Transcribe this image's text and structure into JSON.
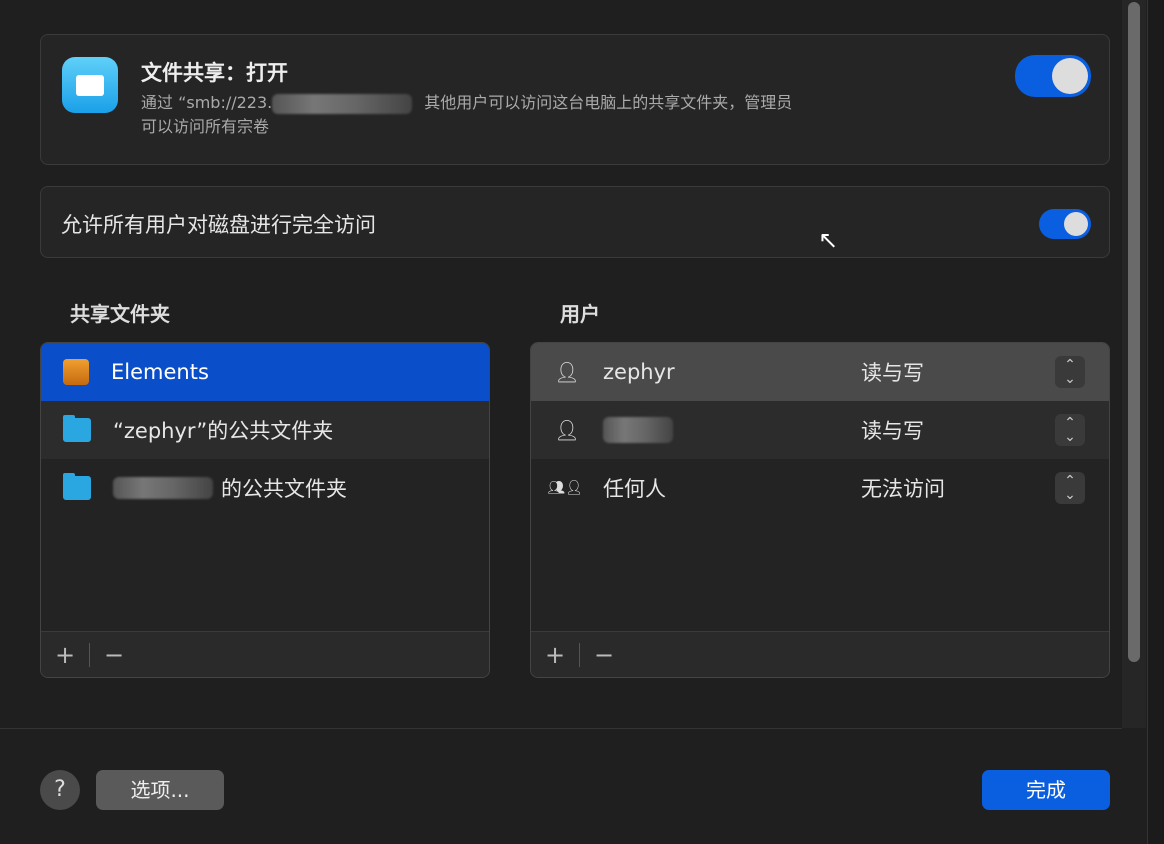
{
  "file_sharing": {
    "title": "文件共享：打开",
    "desc_prefix": "通过 “smb://223.",
    "desc_suffix": "其他用户可以访问这台电脑上的共享文件夹，管理员",
    "desc_line2": "可以访问所有宗卷",
    "enabled": true
  },
  "full_access": {
    "label": "允许所有用户对磁盘进行完全访问",
    "enabled": true
  },
  "shared_folders": {
    "header": "共享文件夹",
    "items": [
      {
        "label": "Elements",
        "icon": "drive-icon",
        "selected": true
      },
      {
        "label": "“zephyr”的公共文件夹",
        "icon": "folder-icon"
      },
      {
        "label": "的公共文件夹",
        "icon": "folder-icon",
        "redacted": true
      }
    ]
  },
  "users": {
    "header": "用户",
    "items": [
      {
        "name": "zephyr",
        "permission": "读与写",
        "icon": "user-icon",
        "selected": true
      },
      {
        "name": "",
        "permission": "读与写",
        "icon": "user-icon",
        "redacted": true
      },
      {
        "name": "任何人",
        "permission": "无法访问",
        "icon": "group-icon"
      }
    ]
  },
  "list_controls": {
    "add": "+",
    "remove": "−"
  },
  "footer": {
    "help": "?",
    "options": "选项...",
    "done": "完成"
  },
  "colors": {
    "accent": "#0a5ee0",
    "selection": "#0a4fc9"
  }
}
